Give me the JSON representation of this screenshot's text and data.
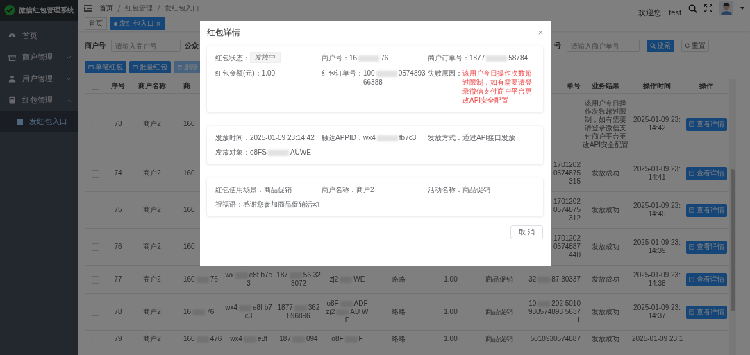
{
  "sidebar": {
    "title": "微信红包管理系统",
    "items": [
      {
        "label": "首页",
        "kind": "link",
        "selected": false
      },
      {
        "label": "商户管理",
        "kind": "group",
        "expanded": false,
        "selected": false
      },
      {
        "label": "用户管理",
        "kind": "group",
        "expanded": false,
        "selected": false
      },
      {
        "label": "红包管理",
        "kind": "group",
        "expanded": true,
        "selected": false,
        "children": [
          {
            "label": "发红包入口",
            "selected": true
          }
        ]
      }
    ]
  },
  "header": {
    "breadcrumb": [
      "首页",
      "红包管理",
      "发红包入口"
    ],
    "welcome": "欢迎您：test"
  },
  "tags": [
    {
      "label": "首页",
      "selected": false
    },
    {
      "label": "发红包入口",
      "selected": true,
      "close": "×"
    }
  ],
  "filters": [
    {
      "label": "商户号",
      "placeholder": "请输入商户号"
    },
    {
      "label": "公众"
    },
    {
      "label": "号",
      "placeholder": "请输入商户单号"
    }
  ],
  "search_button": "搜索",
  "reset_button": "重置",
  "actions": [
    {
      "label": "单笔红包",
      "disabled": false
    },
    {
      "label": "批量红包",
      "disabled": false
    },
    {
      "label": "删除",
      "disabled": true
    }
  ],
  "table": {
    "all_checked": false,
    "columns": [
      "序号",
      "商户名称",
      "商",
      null,
      null,
      null,
      null,
      null,
      null,
      "单号",
      "业务结果",
      "操作时间",
      "操作"
    ],
    "rows": [
      {
        "checked": false,
        "cells": [
          "73",
          "商户2",
          "160",
          null,
          null,
          null,
          null,
          null,
          null,
          null,
          "该用户今日操作次数超过限制，如有需要请登录微信支付商户平台更改API安全配置",
          "2025-01-09 23:14:42",
          "查看详情"
        ]
      },
      {
        "checked": false,
        "cells": [
          "74",
          "商户2",
          "160",
          null,
          null,
          null,
          null,
          null,
          null,
          "17012020574875315",
          "发放成功",
          "2025-01-09 23:14:41",
          "查看详情"
        ]
      },
      {
        "checked": false,
        "cells": [
          "75",
          "商户2",
          "160",
          null,
          null,
          null,
          null,
          null,
          null,
          "17012020574875312",
          "发放成功",
          "2025-01-09 23:14:40",
          "查看详情"
        ]
      },
      {
        "checked": false,
        "cells": [
          "76",
          "商户2",
          "160",
          null,
          null,
          null,
          null,
          null,
          null,
          "17012020574887440",
          "发放成功",
          "2025-01-09 23:14:39",
          "查看详情"
        ]
      },
      {
        "checked": false,
        "cells": [
          "77",
          "商户2",
          [
            "160",
            "76"
          ],
          [
            "wx",
            "e8f b7c3"
          ],
          [
            "187",
            "56 323072"
          ],
          [
            "zj2",
            "WE"
          ],
          "略略",
          "1.00",
          "商品促销",
          [
            "32",
            "87 30337"
          ],
          "发放成功",
          "2025-01-09 23:14:38",
          "查看详情"
        ]
      },
      {
        "checked": false,
        "cells": [
          "78",
          "商户2",
          [
            "16",
            "76"
          ],
          [
            "wx4",
            "e8f b7c3"
          ],
          [
            "1877",
            "362 896896"
          ],
          [
            "o8F",
            "ADF zj2",
            "AU WE"
          ],
          "略略",
          "1.00",
          "商品促销",
          [
            "10",
            "202 5010930574893 56371"
          ],
          "发放成功",
          "2025-01-09 23:14:37",
          "查看详情"
        ]
      },
      {
        "checked": false,
        "cells": [
          "79",
          "商户2",
          [
            "160",
            "476"
          ],
          [
            "wx4",
            "e8f"
          ],
          [
            "187",
            "094"
          ],
          [
            "o8F",
            "F"
          ],
          "略略",
          "1.00",
          "商品促销",
          "5010930574887",
          "发放成功",
          "2025-01-09 23:1",
          null
        ]
      }
    ]
  },
  "dialog": {
    "title": "红包详情",
    "close": "×",
    "sections": [
      {
        "fields": [
          {
            "label": "红包状态：",
            "value": "发放中",
            "kind": "tag"
          },
          {
            "label": "商户号：",
            "value": [
              "16",
              "76"
            ],
            "kind": "text"
          },
          {
            "label": "商户订单号：",
            "value": [
              "1877",
              "58784"
            ],
            "kind": "text"
          },
          {
            "label": "红包金额(元)：",
            "value": "1.00",
            "kind": "text"
          },
          {
            "label": "红包订单号：",
            "value": [
              "100",
              "057489366388"
            ],
            "kind": "text"
          },
          {
            "label": "失败原因：",
            "value": "该用户今日操作次数超过限制，如有需要请登录微信支付商户平台更改API安全配置",
            "kind": "error"
          }
        ]
      },
      {
        "fields": [
          {
            "label": "发放时间：",
            "value": "2025-01-09 23:14:42",
            "kind": "text"
          },
          {
            "label": "触达APPID：",
            "value": [
              "wx4",
              "fb7c3"
            ],
            "kind": "text"
          },
          {
            "label": "发放方式：",
            "value": "通过API接口发放",
            "kind": "text"
          },
          {
            "label": "发放对象：",
            "value": [
              "o8FS",
              "AUWE"
            ],
            "kind": "text"
          }
        ]
      },
      {
        "fields": [
          {
            "label": "红包使用场景：",
            "value": "商品促销",
            "kind": "text"
          },
          {
            "label": "商户名称：",
            "value": "商户2",
            "kind": "text"
          },
          {
            "label": "活动名称：",
            "value": "商品促销",
            "kind": "text"
          },
          {
            "label": "祝福语：",
            "value": "感谢您参加商品促销活动",
            "kind": "text"
          }
        ]
      }
    ],
    "cancel": "取 消"
  }
}
